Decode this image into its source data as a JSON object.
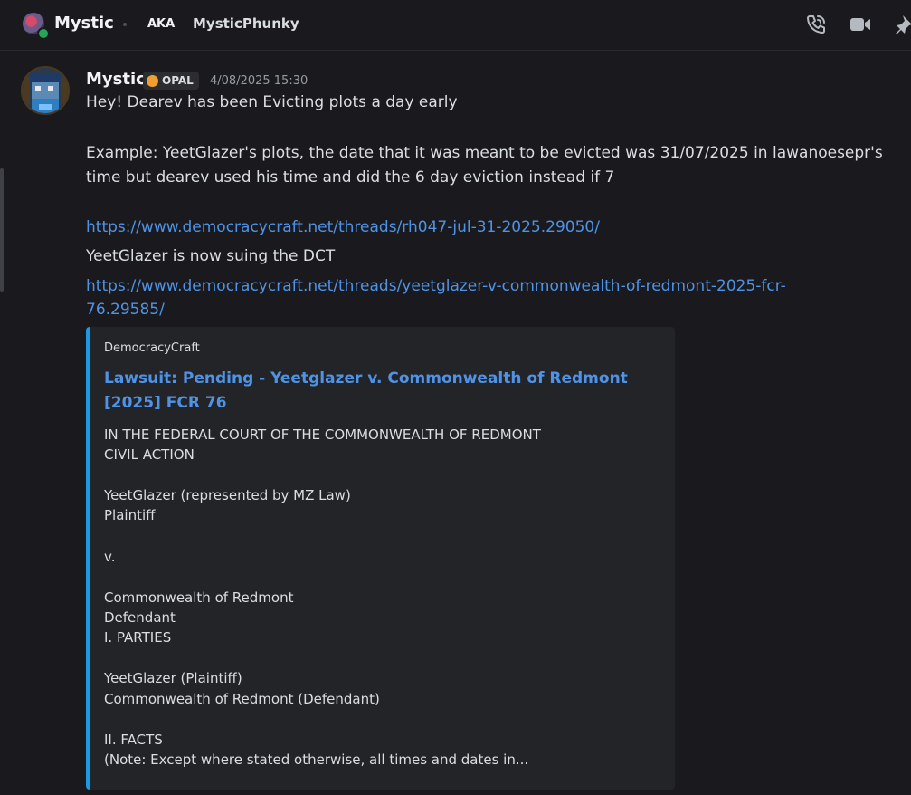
{
  "header": {
    "name": "Mystic",
    "aka_label": "AKA",
    "alias": "MysticPhunky",
    "icons": [
      "voice-call-icon",
      "video-call-icon",
      "pin-icon"
    ]
  },
  "message": {
    "username": "Mystic",
    "tag": "OPAL",
    "timestamp": "4/08/2025 15:30",
    "lines": {
      "l1": "Hey! Dearev has been Evicting plots a day early",
      "l2": "Example: YeetGlazer's plots, the date that it was meant to be evicted was 31/07/2025 in lawanoesepr's",
      "l3": "time but dearev used his time and did the 6 day eviction instead if 7",
      "link1": "https://www.democracycraft.net/threads/rh047-jul-31-2025.29050/",
      "l4": "YeetGlazer is now suing the DCT",
      "link2a": "https://www.democracycraft.net/threads/yeetglazer-v-commonwealth-of-redmont-2025-fcr-",
      "link2b": "76.29585/"
    }
  },
  "embed": {
    "provider": "DemocracyCraft",
    "title": "Lawsuit: Pending - Yeetglazer v. Commonwealth of Redmont [2025] FCR 76",
    "body": [
      "IN THE FEDERAL COURT OF THE COMMONWEALTH OF REDMONT",
      "CIVIL ACTION",
      "YeetGlazer (represented by MZ Law)",
      "Plaintiff",
      "v.",
      "Commonwealth of Redmont",
      "Defendant",
      "I. PARTIES",
      "YeetGlazer (Plaintiff)",
      "Commonwealth of Redmont (Defendant)",
      "II. FACTS",
      "(Note: Except where stated otherwise, all times and dates in..."
    ]
  },
  "colors": {
    "background": "#1a1a1e",
    "link": "#4f93e6",
    "embed_accent": "#1a99e6",
    "online": "#23a55a"
  }
}
